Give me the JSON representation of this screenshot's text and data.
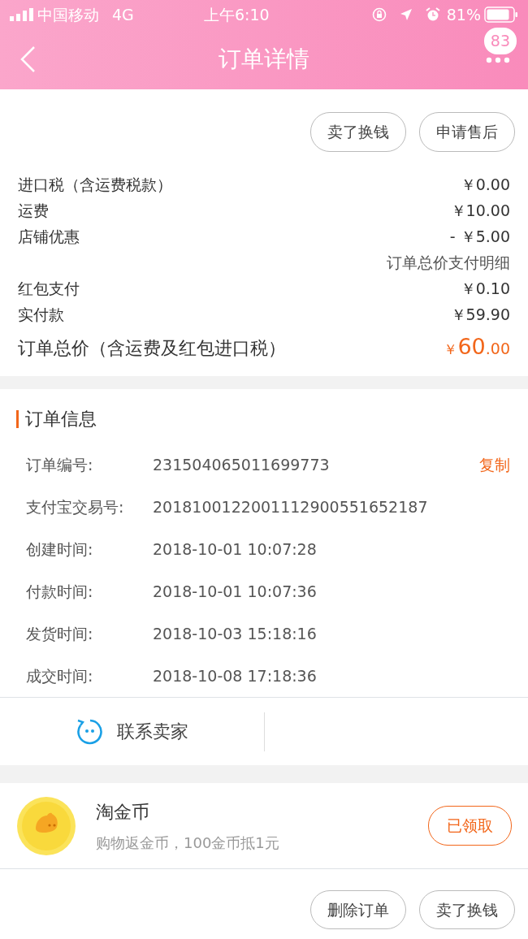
{
  "status_bar": {
    "carrier": "中国移动",
    "network": "4G",
    "time": "上午6:10",
    "battery": "81%"
  },
  "header": {
    "title": "订单详情",
    "badge": "83"
  },
  "top_actions": [
    "卖了换钱",
    "申请售后"
  ],
  "price_rows": [
    {
      "label": "进口税（含运费税款）",
      "value": "￥0.00"
    },
    {
      "label": "运费",
      "value": "￥10.00"
    },
    {
      "label": "店铺优惠",
      "value": "- ￥5.00"
    },
    {
      "kind": "note",
      "value": "订单总价支付明细"
    },
    {
      "label": "红包支付",
      "value": "￥0.10"
    },
    {
      "label": "实付款",
      "value": "￥59.90"
    }
  ],
  "total": {
    "label": "订单总价（含运费及红包进口税）",
    "symbol": "￥",
    "integer": "60",
    "decimal": ".00"
  },
  "order_info": {
    "title": "订单信息",
    "rows": [
      {
        "label": "订单编号:",
        "value": "231504065011699773",
        "action": "复制"
      },
      {
        "label": "支付宝交易号:",
        "value": "2018100122001112900551652187"
      },
      {
        "label": "创建时间:",
        "value": "2018-10-01 10:07:28"
      },
      {
        "label": "付款时间:",
        "value": "2018-10-01 10:07:36"
      },
      {
        "label": "发货时间:",
        "value": "2018-10-03 15:18:16"
      },
      {
        "label": "成交时间:",
        "value": "2018-10-08 17:18:36"
      }
    ]
  },
  "contact": {
    "label": "联系卖家"
  },
  "coins": {
    "title": "淘金币",
    "subtitle": "购物返金币，100金币抵1元",
    "button": "已领取"
  },
  "bottom_actions": [
    "删除订单",
    "卖了换钱"
  ]
}
